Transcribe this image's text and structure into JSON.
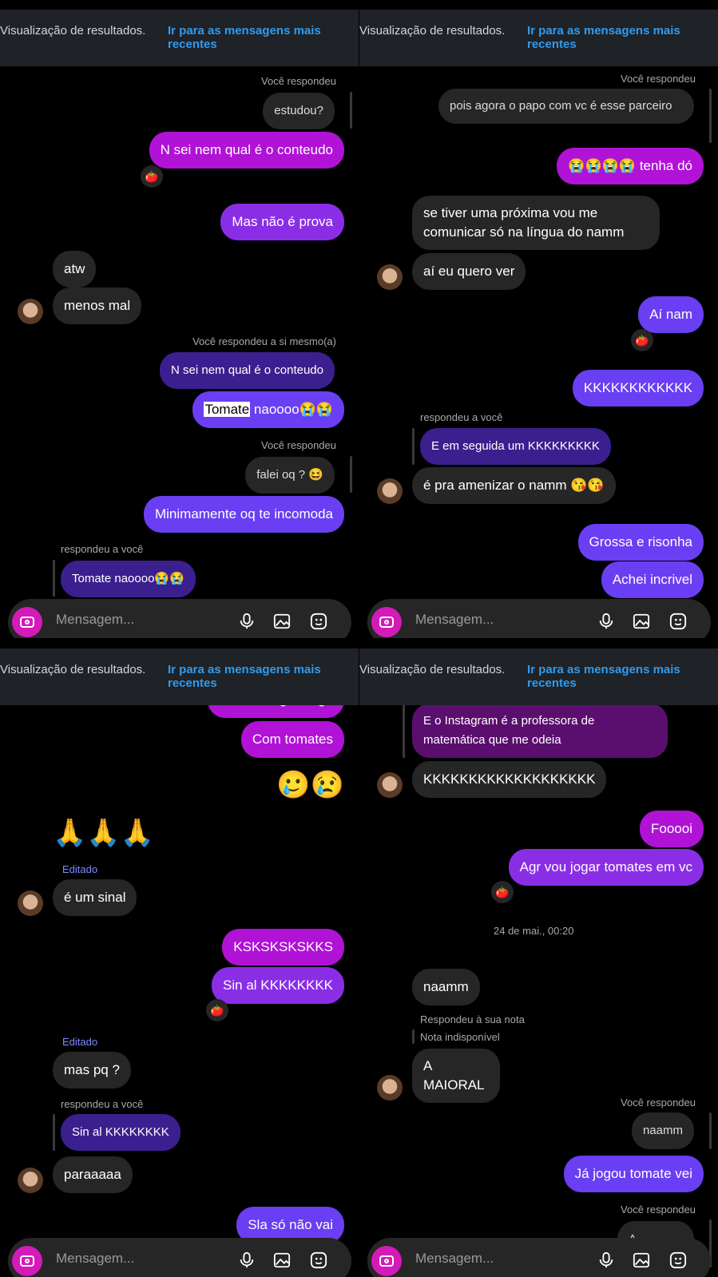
{
  "header": {
    "text": "Visualização de resultados.",
    "link": "Ir para as mensagens mais recentes"
  },
  "composer": {
    "placeholder": "Mensagem..."
  },
  "labels": {
    "you_replied": "Você respondeu",
    "you_replied_self": "Você respondeu a si mesmo(a)",
    "replied_to_you": "respondeu a você",
    "replied_to_note": "Respondeu à sua nota",
    "note_unavailable": "Nota indisponível",
    "edited": "Editado"
  },
  "panels": [
    {
      "messages": [
        "estudou?",
        "N sei nem qual é o conteudo",
        "Mas não é prova",
        "atw",
        "menos mal",
        "N sei nem qual é o conteudo",
        "Tomate",
        " naoooo😭😭",
        "falei oq ? 😆",
        "Minimamente oq te incomoda",
        "Tomate naoooo😭😭"
      ]
    },
    {
      "messages": [
        "pois agora o papo com vc é esse parceiro",
        "😭😭😭😭 tenha dó",
        "se tiver uma próxima vou me comunicar só na língua do namm",
        "aí eu quero ver",
        "Aí nam",
        "KKKKKKKKKKKK",
        "E em seguida um KKKKKKKKK",
        "é pra amenizar o namm 😘😘",
        "Grossa e risonha",
        "Achei incrivel"
      ]
    },
    {
      "messages": [
        "Não consigo reagir",
        "Com tomates",
        "🥲😢",
        "🙏🙏🙏",
        "é um sinal",
        "KSKSKSKSKKS",
        "Sin al KKKKKKKK",
        "mas pq ?",
        "Sin al KKKKKKKK",
        "paraaaaa",
        "Sla só não vai"
      ]
    },
    {
      "messages": [
        "E o Instagram é a professora de matemática que me odeia",
        "KKKKKKKKKKKKKKKKKKK",
        "Fooooi",
        "Agr vou jogar tomates em vc",
        "naamm",
        "A MAIORAL",
        "naamm",
        "Já jogou tomate vei",
        "A"
      ],
      "date": "24 de mai., 00:20"
    }
  ],
  "reaction_emoji": "🍅",
  "colors": {
    "magenta": "#b012d6",
    "purple": "#8a2ee6",
    "violet": "#6a3ef2",
    "incoming": "#262626",
    "link": "#2f9bf0"
  }
}
